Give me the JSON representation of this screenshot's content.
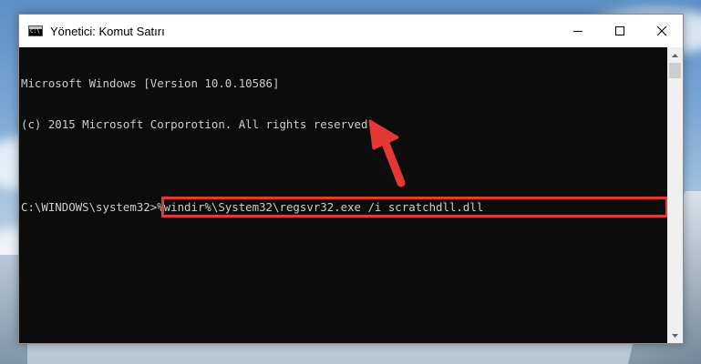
{
  "window": {
    "title": "Yönetici: Komut Satırı",
    "icon": "cmd-icon"
  },
  "controls": {
    "minimize": "minimize-icon",
    "maximize": "maximize-icon",
    "close": "close-icon"
  },
  "console": {
    "lines": [
      "Microsoft Windows [Version 10.0.10586]",
      "(c) 2015 Microsoft Corporotion. All rights reserved."
    ],
    "prompt": "C:\\WINDOWS\\system32>",
    "command": "%windir%\\System32\\regsvr32.exe /i scratchdll.dll",
    "text_color": "#cccccc",
    "background_color": "#0c0c0c"
  },
  "annotation": {
    "highlight_color": "#e53935",
    "arrow_color": "#e53935"
  }
}
